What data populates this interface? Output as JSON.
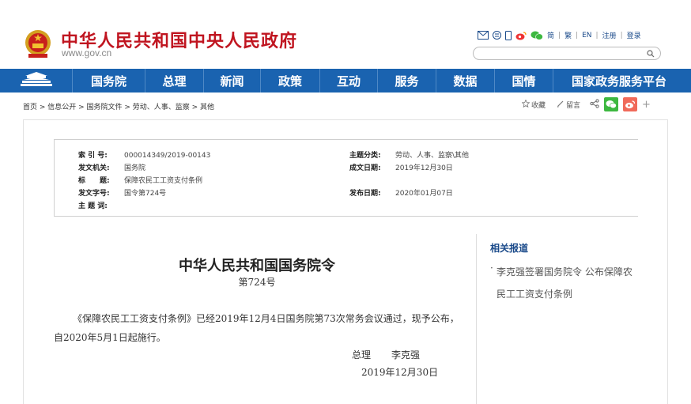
{
  "header": {
    "site_title": "中华人民共和国中央人民政府",
    "site_domain": "www.gov.cn",
    "lang_links": [
      "简",
      "繁",
      "EN",
      "注册",
      "登录"
    ],
    "search_placeholder": ""
  },
  "nav": {
    "items": [
      "国务院",
      "总理",
      "新闻",
      "政策",
      "互动",
      "服务",
      "数据",
      "国情",
      "国家政务服务平台"
    ]
  },
  "breadcrumb": "首页 > 信息公开 > 国务院文件 > 劳动、人事、监察 > 其他",
  "tools": {
    "favorite": "收藏",
    "comment": "留言"
  },
  "info": {
    "index_label": "索 引 号:",
    "index_value": "000014349/2019-00143",
    "org_label": "发文机关:",
    "org_value": "国务院",
    "title_label": "标　　题:",
    "title_value": "保障农民工工资支付条例",
    "docno_label": "发文字号:",
    "docno_value": "国令第724号",
    "keyword_label": "主 题 词:",
    "keyword_value": "",
    "category_label": "主题分类:",
    "category_value": "劳动、人事、监察\\其他",
    "written_label": "成文日期:",
    "written_value": "2019年12月30日",
    "publish_label": "发布日期:",
    "publish_value": "2020年01月07日"
  },
  "document": {
    "title": "中华人民共和国国务院令",
    "number": "第724号",
    "body": "《保障农民工工资支付条例》已经2019年12月4日国务院第73次常务会议通过，现予公布，自2020年5月1日起施行。",
    "signer_title": "总理",
    "signer_name": "李克强",
    "sign_date": "2019年12月30日"
  },
  "related": {
    "title": "相关报道",
    "items": [
      "李克强签署国务院令 公布保障农民工工资支付条例"
    ]
  },
  "colors": {
    "brand_red": "#c01520",
    "nav_blue": "#1a63b0",
    "link_blue": "#1a4a8a"
  }
}
